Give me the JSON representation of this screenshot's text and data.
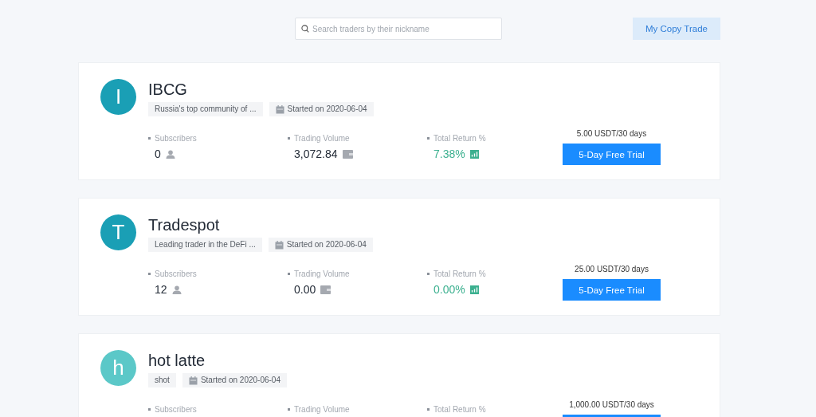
{
  "search": {
    "placeholder": "Search traders by their nickname"
  },
  "my_copy_trade_button": "My Copy Trade",
  "traders": [
    {
      "initial": "I",
      "color": "#1a9fb5",
      "name": "IBCG",
      "description": "Russia's top community of ...",
      "started": "Started on 2020-06-04",
      "metrics": [
        {
          "kind": "subscribers",
          "label": "Subscribers",
          "value": "0"
        },
        {
          "kind": "volume",
          "label": "Trading Volume",
          "value": "3,072.84"
        },
        {
          "kind": "return",
          "label": "Total Return %",
          "value": "7.38%"
        }
      ],
      "price": "5.00 USDT/30 days",
      "button": "5-Day Free Trial"
    },
    {
      "initial": "T",
      "color": "#1a9fb5",
      "name": "Tradespot",
      "description": "Leading trader in the DeFi ...",
      "started": "Started on 2020-06-04",
      "metrics": [
        {
          "kind": "subscribers",
          "label": "Subscribers",
          "value": "12"
        },
        {
          "kind": "volume",
          "label": "Trading Volume",
          "value": "0.00"
        },
        {
          "kind": "return",
          "label": "Total Return %",
          "value": "0.00%"
        }
      ],
      "price": "25.00 USDT/30 days",
      "button": "5-Day Free Trial"
    },
    {
      "initial": "h",
      "color": "#5bc8c8",
      "name": "hot latte",
      "description": "shot",
      "started": "Started on 2020-06-04",
      "metrics": [
        {
          "label": "Subscribers"
        },
        {
          "label": "Trading Volume"
        },
        {
          "label": "Total Return %"
        }
      ],
      "price": "1,000.00 USDT/30 days"
    }
  ]
}
